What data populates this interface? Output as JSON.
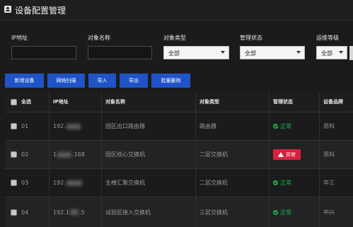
{
  "window": {
    "title": "设备配置管理",
    "icon": "user-card-icon"
  },
  "filters": {
    "ip_label": "IP地址",
    "ip_value": "",
    "name_label": "对象名称",
    "name_value": "",
    "type_label": "对象类型",
    "type_value": "全部",
    "mgmt_label": "管理状态",
    "mgmt_value": "全部",
    "level_label": "运维等级",
    "level_value": "全部"
  },
  "toolbar": {
    "add": "新增设备",
    "scan": "网络扫描",
    "import": "导入",
    "export": "导出",
    "batch_delete": "批量删除"
  },
  "table": {
    "headers": {
      "select_all": "全选",
      "ip": "IP地址",
      "name": "对象名称",
      "type": "对象类型",
      "status": "管理状态",
      "brand": "设备品牌"
    },
    "rows": [
      {
        "no": "01",
        "ip_prefix": "192.",
        "ip_suffix": "",
        "name": "园区出口路由器",
        "type": "路由器",
        "status": "正常",
        "status_kind": "ok",
        "brand": "思科"
      },
      {
        "no": "02",
        "ip_prefix": "1",
        "ip_suffix": ".168",
        "name": "园区核心交换机",
        "type": "二层交换机",
        "status": "异常",
        "status_kind": "error",
        "brand": "思科"
      },
      {
        "no": "03",
        "ip_prefix": "192.",
        "ip_suffix": "",
        "name": "主楼汇聚交换机",
        "type": "二层交换机",
        "status": "正常",
        "status_kind": "ok",
        "brand": "华三"
      },
      {
        "no": "04",
        "ip_prefix": "192.1",
        "ip_suffix": ".5",
        "name": "试验区接入交换机",
        "type": "三层交换机",
        "status": "正常",
        "status_kind": "ok",
        "brand": "中兴"
      }
    ]
  },
  "colors": {
    "background": "#1b1b1d",
    "accent_button": "#1f54c8",
    "status_ok": "#19b54a",
    "status_error": "#d8213c"
  }
}
